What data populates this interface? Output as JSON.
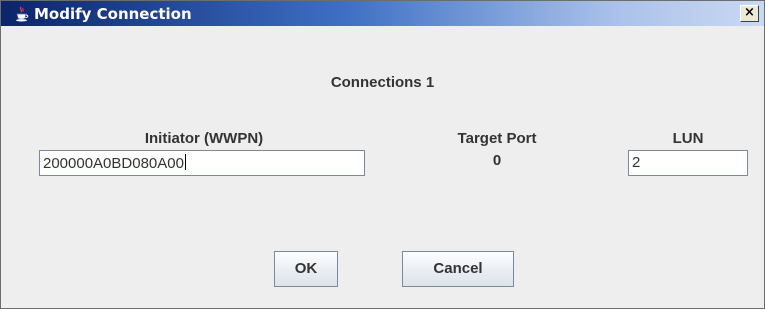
{
  "window": {
    "title": "Modify Connection",
    "close_label": "×"
  },
  "form": {
    "heading": "Connections 1",
    "initiator_label": "Initiator (WWPN)",
    "initiator_value": "200000A0BD080A00",
    "target_port_label": "Target Port",
    "target_port_value": "0",
    "lun_label": "LUN",
    "lun_value": "2"
  },
  "buttons": {
    "ok_label": "OK",
    "cancel_label": "Cancel"
  },
  "colors": {
    "titlebar_dark": "#0b246a",
    "titlebar_light": "#c9d9f3",
    "dialog_bg": "#eeeeee"
  },
  "icons": {
    "title_icon": "java-cup-icon",
    "close_icon": "close-icon"
  }
}
